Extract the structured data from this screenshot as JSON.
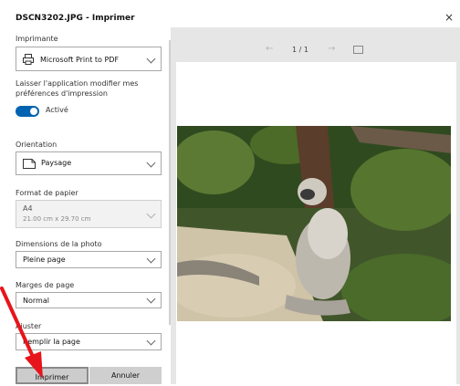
{
  "window": {
    "title": "DSCN3202.JPG - Imprimer",
    "close_glyph": "×"
  },
  "printer": {
    "label": "Imprimante",
    "value": "Microsoft Print to PDF"
  },
  "app_settings": {
    "label_line1": "Laisser l'application modifier mes",
    "label_line2": "préférences d'impression",
    "toggle_text": "Activé",
    "toggle_on": true
  },
  "orientation": {
    "label": "Orientation",
    "value": "Paysage"
  },
  "paper_format": {
    "label": "Format de papier",
    "value": "A4",
    "detail": "21.00 cm x 29.70 cm"
  },
  "photo_size": {
    "label": "Dimensions de la photo",
    "value": "Pleine page"
  },
  "margins": {
    "label": "Marges de page",
    "value": "Normal"
  },
  "fit": {
    "label": "Ajuster",
    "value": "Remplir la page"
  },
  "buttons": {
    "print": "Imprimer",
    "cancel": "Annuler"
  },
  "preview": {
    "page_indicator": "1 / 1"
  },
  "colors": {
    "accent": "#0063b1",
    "annotation_arrow": "#e8141b"
  }
}
